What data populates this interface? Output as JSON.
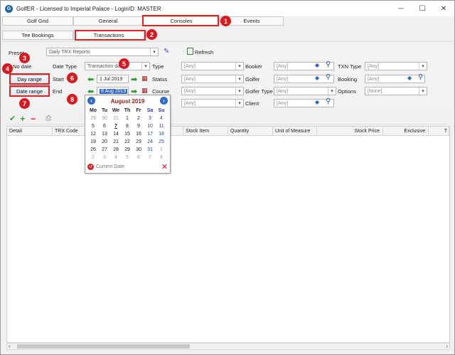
{
  "window": {
    "title": "GolfER - Licensed to Imperial Palace - LoginID: MASTER"
  },
  "tabs": [
    "Golf Grid",
    "General",
    "Consoles",
    "Events"
  ],
  "subtabs": [
    "Tee Bookings",
    "Transactions"
  ],
  "badges": [
    "1",
    "2",
    "3",
    "4",
    "5",
    "6",
    "7",
    "8"
  ],
  "preset": {
    "label": "Preset",
    "value": "Daily TRX Reports",
    "refresh": "Refresh"
  },
  "filters": {
    "no_date": "No date",
    "day_range": "Day range",
    "date_range": "Date range",
    "date_type_label": "Date Type",
    "date_type_value": "Transaction date",
    "start_label": "Start",
    "start_value": "1 Jul 2019",
    "end_label": "End",
    "end_value": "8 Aug 2019",
    "type_label": "Type",
    "status_label": "Status",
    "course_label": "Course",
    "booker_label": "Booker",
    "golfer_label": "Golfer",
    "golfer_type_label": "Golfer Type",
    "client_label": "Client",
    "txn_type_label": "TXN Type",
    "booking_label": "Booking",
    "options_label": "Options",
    "any": "[Any]",
    "none": "[None]"
  },
  "grid": {
    "columns": [
      "Detail",
      "TRX Code",
      "Stock Item",
      "Quantity",
      "Unit of Measure",
      "Stock Price",
      "Exclusive",
      "T"
    ]
  },
  "calendar": {
    "month": "August 2019",
    "dow": [
      "Mo",
      "Tu",
      "We",
      "Th",
      "Fr",
      "Sa",
      "Su"
    ],
    "weeks": [
      [
        "29",
        "30",
        "31",
        "1",
        "2",
        "3",
        "4"
      ],
      [
        "5",
        "6",
        "7",
        "8",
        "9",
        "10",
        "11"
      ],
      [
        "12",
        "13",
        "14",
        "15",
        "16",
        "17",
        "18"
      ],
      [
        "19",
        "20",
        "21",
        "22",
        "23",
        "24",
        "25"
      ],
      [
        "26",
        "27",
        "28",
        "29",
        "30",
        "31",
        "1"
      ],
      [
        "2",
        "3",
        "4",
        "5",
        "6",
        "7",
        "8"
      ]
    ],
    "current_date": "Current Date"
  },
  "colors": {
    "badge": "#d71920",
    "highlight": "#e52020",
    "accent": "#2d6bc6",
    "green": "#2a9d2a"
  }
}
